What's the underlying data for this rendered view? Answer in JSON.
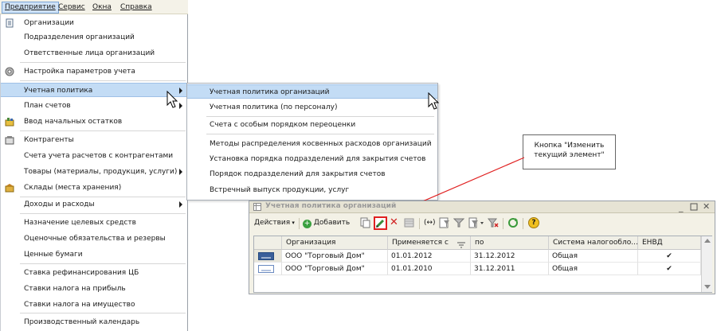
{
  "menubar": {
    "items": [
      {
        "label": "Предприятие"
      },
      {
        "label": "Сервис"
      },
      {
        "label": "Окна"
      },
      {
        "label": "Справка"
      }
    ]
  },
  "left_menu": {
    "items": [
      {
        "label": "Организации",
        "icon": "organizations-icon"
      },
      {
        "label": "Подразделения организаций"
      },
      {
        "label": "Ответственные лица организаций"
      },
      {
        "label": "Настройка параметров учета",
        "icon": "settings-icon"
      },
      {
        "label": "Учетная политика",
        "has_submenu": true,
        "highlighted": true
      },
      {
        "label": "План счетов",
        "has_submenu": true
      },
      {
        "label": "Ввод начальных остатков",
        "icon": "opening-balances-icon"
      },
      {
        "label": "Контрагенты",
        "icon": "contractors-icon"
      },
      {
        "label": "Счета учета расчетов с контрагентами"
      },
      {
        "label": "Товары (материалы, продукция, услуги)",
        "has_submenu": true
      },
      {
        "label": "Склады (места хранения)",
        "icon": "warehouse-icon"
      },
      {
        "label": "Доходы и расходы",
        "has_submenu": true
      },
      {
        "label": "Назначение целевых средств"
      },
      {
        "label": "Оценочные обязательства и резервы"
      },
      {
        "label": "Ценные бумаги"
      },
      {
        "label": "Ставка рефинансирования ЦБ"
      },
      {
        "label": "Ставки налога на прибыль"
      },
      {
        "label": "Ставки налога на имущество"
      },
      {
        "label": "Производственный календарь"
      }
    ]
  },
  "sub_menu": {
    "items": [
      {
        "label": "Учетная политика организаций",
        "highlighted": true
      },
      {
        "label": "Учетная политика (по персоналу)"
      },
      {
        "label": "Счета с особым порядком переоценки"
      },
      {
        "label": "Методы распределения косвенных расходов организаций"
      },
      {
        "label": "Установка порядка подразделений для закрытия счетов"
      },
      {
        "label": "Порядок подразделений для закрытия счетов"
      },
      {
        "label": "Встречный выпуск продукции, услуг"
      }
    ]
  },
  "callout": {
    "line1": "Кнопка \"Изменить",
    "line2": "текущий элемент\""
  },
  "window": {
    "title": "Учетная политика организаций",
    "toolbar": {
      "actions_label": "Действия",
      "add_label": "Добавить"
    },
    "table": {
      "columns": [
        "Организация",
        "Применяется с",
        "по",
        "Система налогообло...",
        "ЕНВД"
      ],
      "rows": [
        {
          "org": "ООО \"Торговый Дом\"",
          "from": "01.01.2012",
          "to": "31.12.2012",
          "tax": "Общая",
          "envd": "✔"
        },
        {
          "org": "ООО \"Торговый Дом\"",
          "from": "01.01.2010",
          "to": "31.12.2011",
          "tax": "Общая",
          "envd": "✔"
        }
      ]
    }
  },
  "colors": {
    "highlight": "#c3dcf5",
    "callout_line": "#e02020",
    "edit_button_frame": "#e02020"
  }
}
